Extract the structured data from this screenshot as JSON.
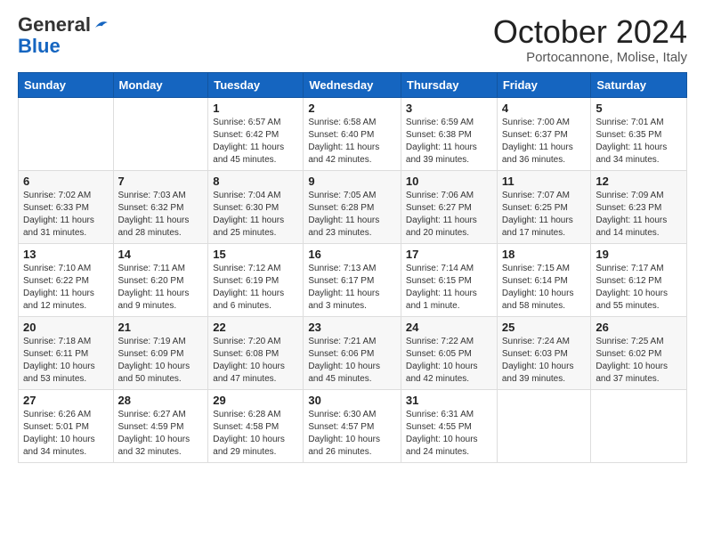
{
  "logo": {
    "general": "General",
    "blue": "Blue"
  },
  "header": {
    "month": "October 2024",
    "location": "Portocannone, Molise, Italy"
  },
  "weekdays": [
    "Sunday",
    "Monday",
    "Tuesday",
    "Wednesday",
    "Thursday",
    "Friday",
    "Saturday"
  ],
  "weeks": [
    [
      null,
      null,
      {
        "day": 1,
        "sunrise": "6:57 AM",
        "sunset": "6:42 PM",
        "daylight": "11 hours and 45 minutes."
      },
      {
        "day": 2,
        "sunrise": "6:58 AM",
        "sunset": "6:40 PM",
        "daylight": "11 hours and 42 minutes."
      },
      {
        "day": 3,
        "sunrise": "6:59 AM",
        "sunset": "6:38 PM",
        "daylight": "11 hours and 39 minutes."
      },
      {
        "day": 4,
        "sunrise": "7:00 AM",
        "sunset": "6:37 PM",
        "daylight": "11 hours and 36 minutes."
      },
      {
        "day": 5,
        "sunrise": "7:01 AM",
        "sunset": "6:35 PM",
        "daylight": "11 hours and 34 minutes."
      }
    ],
    [
      {
        "day": 6,
        "sunrise": "7:02 AM",
        "sunset": "6:33 PM",
        "daylight": "11 hours and 31 minutes."
      },
      {
        "day": 7,
        "sunrise": "7:03 AM",
        "sunset": "6:32 PM",
        "daylight": "11 hours and 28 minutes."
      },
      {
        "day": 8,
        "sunrise": "7:04 AM",
        "sunset": "6:30 PM",
        "daylight": "11 hours and 25 minutes."
      },
      {
        "day": 9,
        "sunrise": "7:05 AM",
        "sunset": "6:28 PM",
        "daylight": "11 hours and 23 minutes."
      },
      {
        "day": 10,
        "sunrise": "7:06 AM",
        "sunset": "6:27 PM",
        "daylight": "11 hours and 20 minutes."
      },
      {
        "day": 11,
        "sunrise": "7:07 AM",
        "sunset": "6:25 PM",
        "daylight": "11 hours and 17 minutes."
      },
      {
        "day": 12,
        "sunrise": "7:09 AM",
        "sunset": "6:23 PM",
        "daylight": "11 hours and 14 minutes."
      }
    ],
    [
      {
        "day": 13,
        "sunrise": "7:10 AM",
        "sunset": "6:22 PM",
        "daylight": "11 hours and 12 minutes."
      },
      {
        "day": 14,
        "sunrise": "7:11 AM",
        "sunset": "6:20 PM",
        "daylight": "11 hours and 9 minutes."
      },
      {
        "day": 15,
        "sunrise": "7:12 AM",
        "sunset": "6:19 PM",
        "daylight": "11 hours and 6 minutes."
      },
      {
        "day": 16,
        "sunrise": "7:13 AM",
        "sunset": "6:17 PM",
        "daylight": "11 hours and 3 minutes."
      },
      {
        "day": 17,
        "sunrise": "7:14 AM",
        "sunset": "6:15 PM",
        "daylight": "11 hours and 1 minute."
      },
      {
        "day": 18,
        "sunrise": "7:15 AM",
        "sunset": "6:14 PM",
        "daylight": "10 hours and 58 minutes."
      },
      {
        "day": 19,
        "sunrise": "7:17 AM",
        "sunset": "6:12 PM",
        "daylight": "10 hours and 55 minutes."
      }
    ],
    [
      {
        "day": 20,
        "sunrise": "7:18 AM",
        "sunset": "6:11 PM",
        "daylight": "10 hours and 53 minutes."
      },
      {
        "day": 21,
        "sunrise": "7:19 AM",
        "sunset": "6:09 PM",
        "daylight": "10 hours and 50 minutes."
      },
      {
        "day": 22,
        "sunrise": "7:20 AM",
        "sunset": "6:08 PM",
        "daylight": "10 hours and 47 minutes."
      },
      {
        "day": 23,
        "sunrise": "7:21 AM",
        "sunset": "6:06 PM",
        "daylight": "10 hours and 45 minutes."
      },
      {
        "day": 24,
        "sunrise": "7:22 AM",
        "sunset": "6:05 PM",
        "daylight": "10 hours and 42 minutes."
      },
      {
        "day": 25,
        "sunrise": "7:24 AM",
        "sunset": "6:03 PM",
        "daylight": "10 hours and 39 minutes."
      },
      {
        "day": 26,
        "sunrise": "7:25 AM",
        "sunset": "6:02 PM",
        "daylight": "10 hours and 37 minutes."
      }
    ],
    [
      {
        "day": 27,
        "sunrise": "6:26 AM",
        "sunset": "5:01 PM",
        "daylight": "10 hours and 34 minutes."
      },
      {
        "day": 28,
        "sunrise": "6:27 AM",
        "sunset": "4:59 PM",
        "daylight": "10 hours and 32 minutes."
      },
      {
        "day": 29,
        "sunrise": "6:28 AM",
        "sunset": "4:58 PM",
        "daylight": "10 hours and 29 minutes."
      },
      {
        "day": 30,
        "sunrise": "6:30 AM",
        "sunset": "4:57 PM",
        "daylight": "10 hours and 26 minutes."
      },
      {
        "day": 31,
        "sunrise": "6:31 AM",
        "sunset": "4:55 PM",
        "daylight": "10 hours and 24 minutes."
      },
      null,
      null
    ]
  ]
}
